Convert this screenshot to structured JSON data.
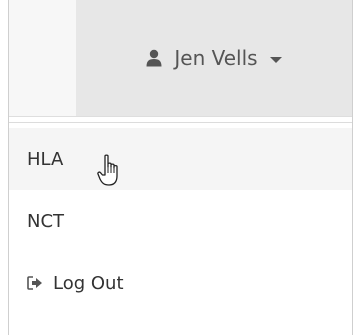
{
  "user_menu": {
    "username": "Jen Vells",
    "user_icon": "user-icon",
    "caret_icon": "chevron-down-icon"
  },
  "menu": {
    "items": [
      {
        "label": "HLA"
      },
      {
        "label": "NCT"
      },
      {
        "label": "Log Out",
        "icon": "sign-out-icon"
      }
    ]
  },
  "colors": {
    "navbar_bg": "#f7f7f7",
    "toggle_bg": "#e7e7e7",
    "hover_bg": "#f5f5f5",
    "text": "#333333"
  }
}
